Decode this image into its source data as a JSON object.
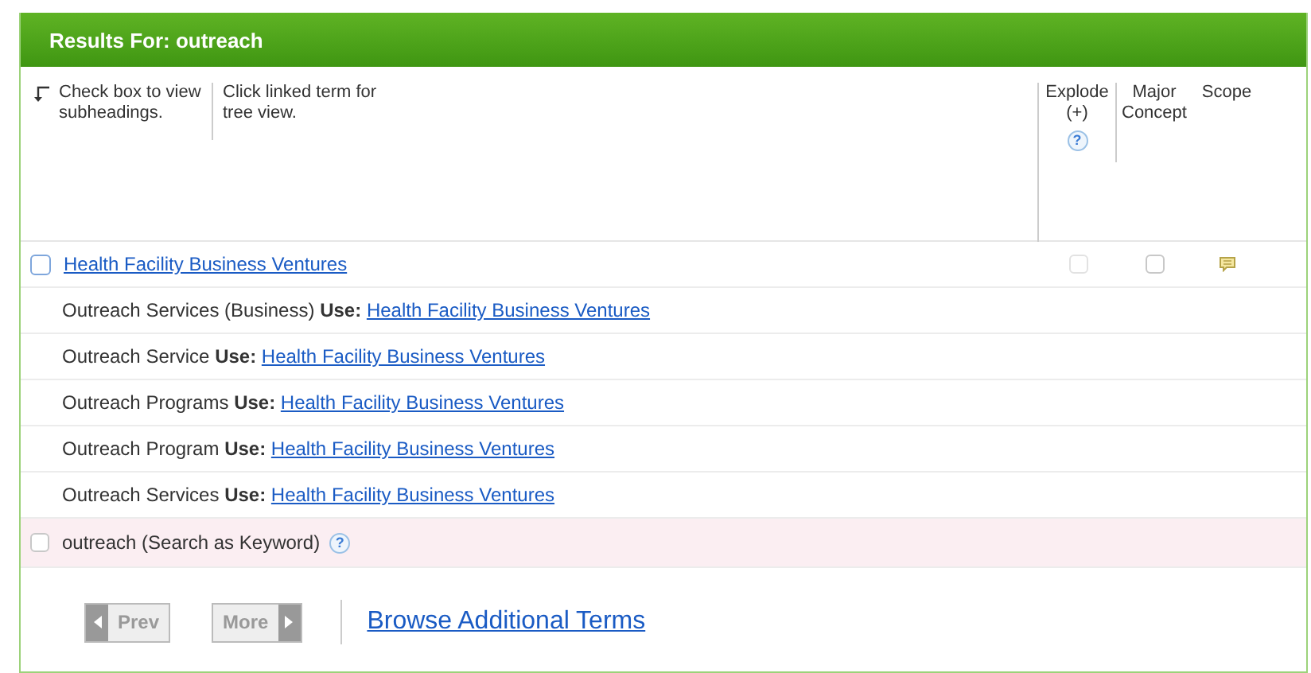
{
  "panel": {
    "title": "Results For: outreach"
  },
  "instructions": [
    {
      "text": "Check box to view subheadings."
    },
    {
      "text": "Click linked term for tree view."
    }
  ],
  "columns": [
    {
      "label": "Explode (+)",
      "help": "?"
    },
    {
      "label": "Major Concept"
    },
    {
      "label": "Scope"
    }
  ],
  "term": {
    "label": "Health Facility Business Ventures",
    "checked": false,
    "explode_checked": false,
    "major_checked": false
  },
  "see_references": [
    {
      "entry": "Outreach Services (Business)",
      "label": "Use:",
      "target": "Health Facility Business Ventures"
    },
    {
      "entry": "Outreach Service",
      "label": "Use:",
      "target": "Health Facility Business Ventures"
    },
    {
      "entry": "Outreach Programs",
      "label": "Use:",
      "target": "Health Facility Business Ventures"
    },
    {
      "entry": "Outreach Program",
      "label": "Use:",
      "target": "Health Facility Business Ventures"
    },
    {
      "entry": "Outreach Services",
      "label": "Use:",
      "target": "Health Facility Business Ventures"
    }
  ],
  "keyword": {
    "label": "outreach (Search as Keyword)",
    "help": "?",
    "checked": false
  },
  "pager": {
    "prev": {
      "label": "Prev",
      "disabled": true
    },
    "more": {
      "label": "More",
      "disabled": true
    },
    "browse": "Browse Additional Terms"
  }
}
